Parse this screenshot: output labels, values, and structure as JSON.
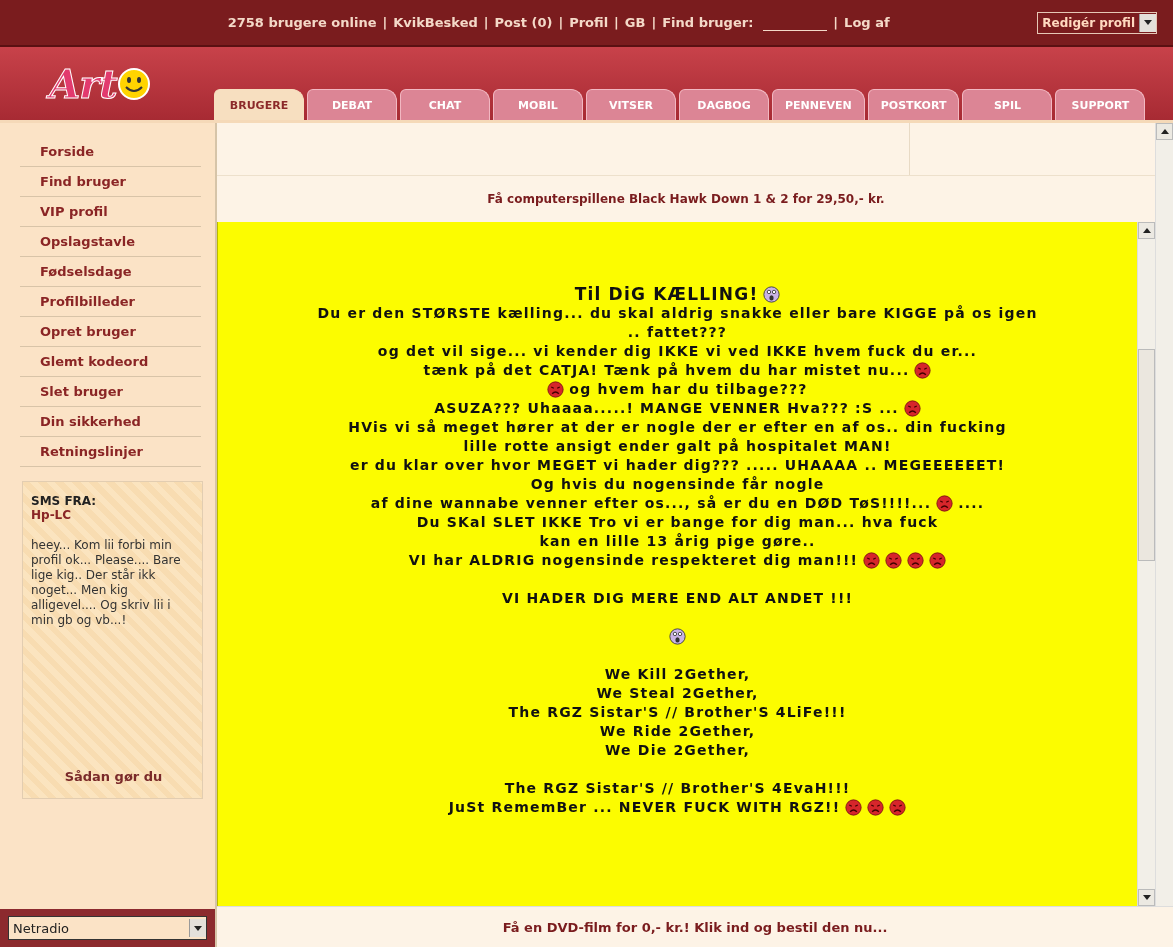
{
  "top_bar": {
    "separator": "|",
    "items": [
      {
        "kind": "text",
        "text": "2758 brugere online"
      },
      {
        "kind": "link",
        "text": "KvikBesked"
      },
      {
        "kind": "link",
        "text": "Post (0)"
      },
      {
        "kind": "link",
        "text": "Profil"
      },
      {
        "kind": "link",
        "text": "GB"
      },
      {
        "kind": "field",
        "text": "Find bruger:"
      },
      {
        "kind": "link",
        "text": "Log af"
      }
    ],
    "profile_select": "Redigér profil"
  },
  "logo": {
    "text": "Art"
  },
  "tabs": [
    {
      "label": "BRUGERE",
      "selected": true
    },
    {
      "label": "DEBAT",
      "selected": false
    },
    {
      "label": "CHAT",
      "selected": false
    },
    {
      "label": "MOBIL",
      "selected": false
    },
    {
      "label": "VITSER",
      "selected": false
    },
    {
      "label": "DAGBOG",
      "selected": false
    },
    {
      "label": "PENNEVEN",
      "selected": false
    },
    {
      "label": "POSTKORT",
      "selected": false
    },
    {
      "label": "SPIL",
      "selected": false
    },
    {
      "label": "SUPPORT",
      "selected": false
    }
  ],
  "sidebar": {
    "items": [
      "Forside",
      "Find bruger",
      "VIP profil",
      "Opslagstavle",
      "Fødselsdage",
      "Profilbilleder",
      "Opret bruger",
      "Glemt kodeord",
      "Slet bruger",
      "Din sikkerhed",
      "Retningslinjer"
    ],
    "sms": {
      "heading": "SMS FRA:",
      "sender": "Hp-LC",
      "message": "heey... Kom lii forbi min profil ok... Please.... Bare lige kig.. Der står ikk noget... Men kig alligevel.... Og skriv lii i min gb og vb...!",
      "link": "Sådan gør du"
    },
    "radio_select": "Netradio"
  },
  "top_ad": "Få computerspillene Black Hawk Down 1 & 2 for 29,50,- kr.",
  "message": {
    "lines": [
      {
        "kind": "gap"
      },
      {
        "kind": "title",
        "segments": [
          {
            "kind": "text",
            "text": "Til DiG KÆLLING!"
          },
          {
            "kind": "shocked"
          }
        ]
      },
      {
        "kind": "text",
        "segments": [
          {
            "kind": "text",
            "text": "Du er den STØRSTE kælling... du skal aldrig snakke eller bare KIGGE på os igen"
          }
        ]
      },
      {
        "kind": "text",
        "segments": [
          {
            "kind": "text",
            "text": ".. fattet???"
          }
        ]
      },
      {
        "kind": "text",
        "segments": [
          {
            "kind": "text",
            "text": "og det vil sige... vi kender dig IKKE vi ved IKKE hvem fuck du er..."
          }
        ]
      },
      {
        "kind": "text",
        "segments": [
          {
            "kind": "text",
            "text": "tænk på det CATJA! Tænk på hvem du har mistet nu..."
          },
          {
            "kind": "angry"
          }
        ]
      },
      {
        "kind": "text",
        "segments": [
          {
            "kind": "angry"
          },
          {
            "kind": "text",
            "text": "og hvem har du tilbage???"
          }
        ]
      },
      {
        "kind": "text",
        "segments": [
          {
            "kind": "text",
            "text": "ASUZA??? Uhaaaa.....! MANGE VENNER Hva??? :S ..."
          },
          {
            "kind": "angry"
          }
        ]
      },
      {
        "kind": "text",
        "segments": [
          {
            "kind": "text",
            "text": "HVis vi så meget hører at der er nogle der er efter en af os.. din fucking"
          }
        ]
      },
      {
        "kind": "text",
        "segments": [
          {
            "kind": "text",
            "text": "lille rotte ansigt ender galt på hospitalet MAN!"
          }
        ]
      },
      {
        "kind": "text",
        "segments": [
          {
            "kind": "text",
            "text": "er du klar over hvor MEGET vi hader dig??? ..... UHAAAA .. MEGEEEEEET!"
          }
        ]
      },
      {
        "kind": "text",
        "segments": [
          {
            "kind": "text",
            "text": "Og hvis du nogensinde får nogle"
          }
        ]
      },
      {
        "kind": "text",
        "segments": [
          {
            "kind": "text",
            "text": "af dine wannabe venner efter os..., så er du en DØD TøS!!!!..."
          },
          {
            "kind": "angry"
          },
          {
            "kind": "text",
            "text": "...."
          }
        ]
      },
      {
        "kind": "text",
        "segments": [
          {
            "kind": "text",
            "text": "Du SKal SLET IKKE Tro vi er bange for dig man... hva fuck"
          }
        ]
      },
      {
        "kind": "text",
        "segments": [
          {
            "kind": "text",
            "text": "kan en lille 13 årig pige gøre.."
          }
        ]
      },
      {
        "kind": "text",
        "segments": [
          {
            "kind": "text",
            "text": "VI har ALDRIG nogensinde respekteret dig man!!!"
          },
          {
            "kind": "angry"
          },
          {
            "kind": "angry"
          },
          {
            "kind": "angry"
          },
          {
            "kind": "angry"
          }
        ]
      },
      {
        "kind": "gap"
      },
      {
        "kind": "text",
        "segments": [
          {
            "kind": "text",
            "text": "VI HADER DIG MERE END ALT ANDET !!!"
          }
        ]
      },
      {
        "kind": "gap"
      },
      {
        "kind": "text",
        "segments": [
          {
            "kind": "shocked"
          }
        ]
      },
      {
        "kind": "gap"
      },
      {
        "kind": "text",
        "segments": [
          {
            "kind": "text",
            "text": "We Kill 2Gether,"
          }
        ]
      },
      {
        "kind": "text",
        "segments": [
          {
            "kind": "text",
            "text": "We Steal 2Gether,"
          }
        ]
      },
      {
        "kind": "text",
        "segments": [
          {
            "kind": "text",
            "text": "The RGZ Sistar'S // Brother'S 4LiFe!!!"
          }
        ]
      },
      {
        "kind": "text",
        "segments": [
          {
            "kind": "text",
            "text": "We Ride 2Gether,"
          }
        ]
      },
      {
        "kind": "text",
        "segments": [
          {
            "kind": "text",
            "text": "We Die 2Gether,"
          }
        ]
      },
      {
        "kind": "gap"
      },
      {
        "kind": "text",
        "segments": [
          {
            "kind": "text",
            "text": "The RGZ Sistar'S // Brother'S 4EvaH!!!"
          }
        ]
      },
      {
        "kind": "text",
        "segments": [
          {
            "kind": "text",
            "text": "JuSt RememBer ... NEVER FUCK WITH RGZ!!"
          },
          {
            "kind": "angry"
          },
          {
            "kind": "angry"
          },
          {
            "kind": "angry"
          }
        ]
      }
    ]
  },
  "bottom_ad": "Få en DVD-film for 0,- kr.! Klik ind og bestil den nu..."
}
